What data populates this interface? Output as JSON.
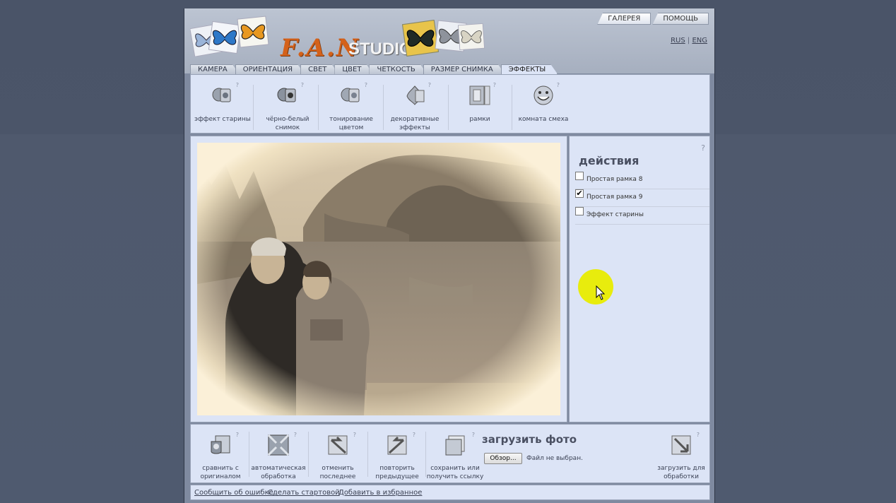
{
  "header": {
    "logo_fan": "F.A.N",
    "logo_studio": "STUDIO",
    "top_tabs": [
      {
        "label": "ГАЛЕРЕЯ"
      },
      {
        "label": "ПОМОЩЬ"
      }
    ],
    "lang": {
      "rus": "RUS",
      "sep": "|",
      "eng": "ENG"
    }
  },
  "tabs": [
    {
      "label": "КАМЕРА"
    },
    {
      "label": "ОРИЕНТАЦИЯ"
    },
    {
      "label": "СВЕТ"
    },
    {
      "label": "ЦВЕТ"
    },
    {
      "label": "ЧЕТКОСТЬ"
    },
    {
      "label": "РАЗМЕР СНИМКА"
    },
    {
      "label": "ЭФФЕКТЫ"
    }
  ],
  "active_tab": "ЭФФЕКТЫ",
  "effects": [
    {
      "label": "эффект старины",
      "icon": "vintage-effect-icon"
    },
    {
      "label": "чёрно-белый снимок",
      "icon": "black-white-icon"
    },
    {
      "label": "тонирование цветом",
      "icon": "color-toning-icon"
    },
    {
      "label": "декоративные эффекты",
      "icon": "decorative-icon"
    },
    {
      "label": "рамки",
      "icon": "frames-icon"
    },
    {
      "label": "комната смеха",
      "icon": "funhouse-icon"
    }
  ],
  "help_mark": "?",
  "actions": {
    "title": "действия",
    "items": [
      {
        "label": "Простая рамка 8",
        "checked": false
      },
      {
        "label": "Простая рамка 9",
        "checked": true
      },
      {
        "label": "Эффект старины",
        "checked": false
      }
    ]
  },
  "bottom": {
    "buttons": [
      {
        "label": "сравнить с оригиналом",
        "icon": "compare-icon"
      },
      {
        "label": "автоматическая обработка",
        "icon": "auto-process-icon"
      },
      {
        "label": "отменить последнее",
        "icon": "undo-icon"
      },
      {
        "label": "повторить предыдущее",
        "icon": "redo-icon"
      },
      {
        "label": "сохранить или получить ссылку",
        "icon": "save-icon"
      }
    ],
    "upload_title": "загрузить фото",
    "browse_label": "Обзор...",
    "no_file": "Файл не выбран.",
    "upload_process": "загрузить для обработки"
  },
  "footer": {
    "links": [
      {
        "label": "Сообщить об ошибке"
      },
      {
        "label": "Сделать стартовой"
      },
      {
        "label": "Добавить в избранное"
      }
    ]
  },
  "colors": {
    "panel_bg": "#dce4f6",
    "page_bg": "#4f596d",
    "sepia": "#a89884",
    "cursor_highlight": "#e8ec00"
  }
}
